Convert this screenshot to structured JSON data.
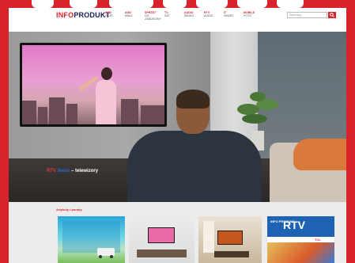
{
  "header": {
    "logo_main_left": "INFO",
    "logo_main_right": "PRODUKT",
    "logo_sub": "",
    "nav": [
      {
        "top": "AGD",
        "bottom": "duże"
      },
      {
        "top": "AGD",
        "bottom": "małe"
      },
      {
        "top": "Sprzęt",
        "bottom": "do zabudowy"
      },
      {
        "top": "TV",
        "bottom": "SAT"
      },
      {
        "top": "Audio",
        "bottom": "wideo"
      },
      {
        "top": "RTV",
        "bottom": "audio"
      },
      {
        "top": "IT",
        "bottom": "smart"
      },
      {
        "top": "Mobile",
        "bottom": "foto"
      }
    ],
    "search_placeholder": "Wyszukaj..."
  },
  "hero": {
    "caption_red": "RTV",
    "caption_blue": "News",
    "caption_white": " – telewizory"
  },
  "articles": {
    "title": "Artykuły i porady"
  },
  "magazine": {
    "logo": "INFO PRODUKT",
    "title": "RTV",
    "badge": "TCL"
  },
  "colors": {
    "brand_red": "#d8232a",
    "navy": "#1a1a5a"
  }
}
